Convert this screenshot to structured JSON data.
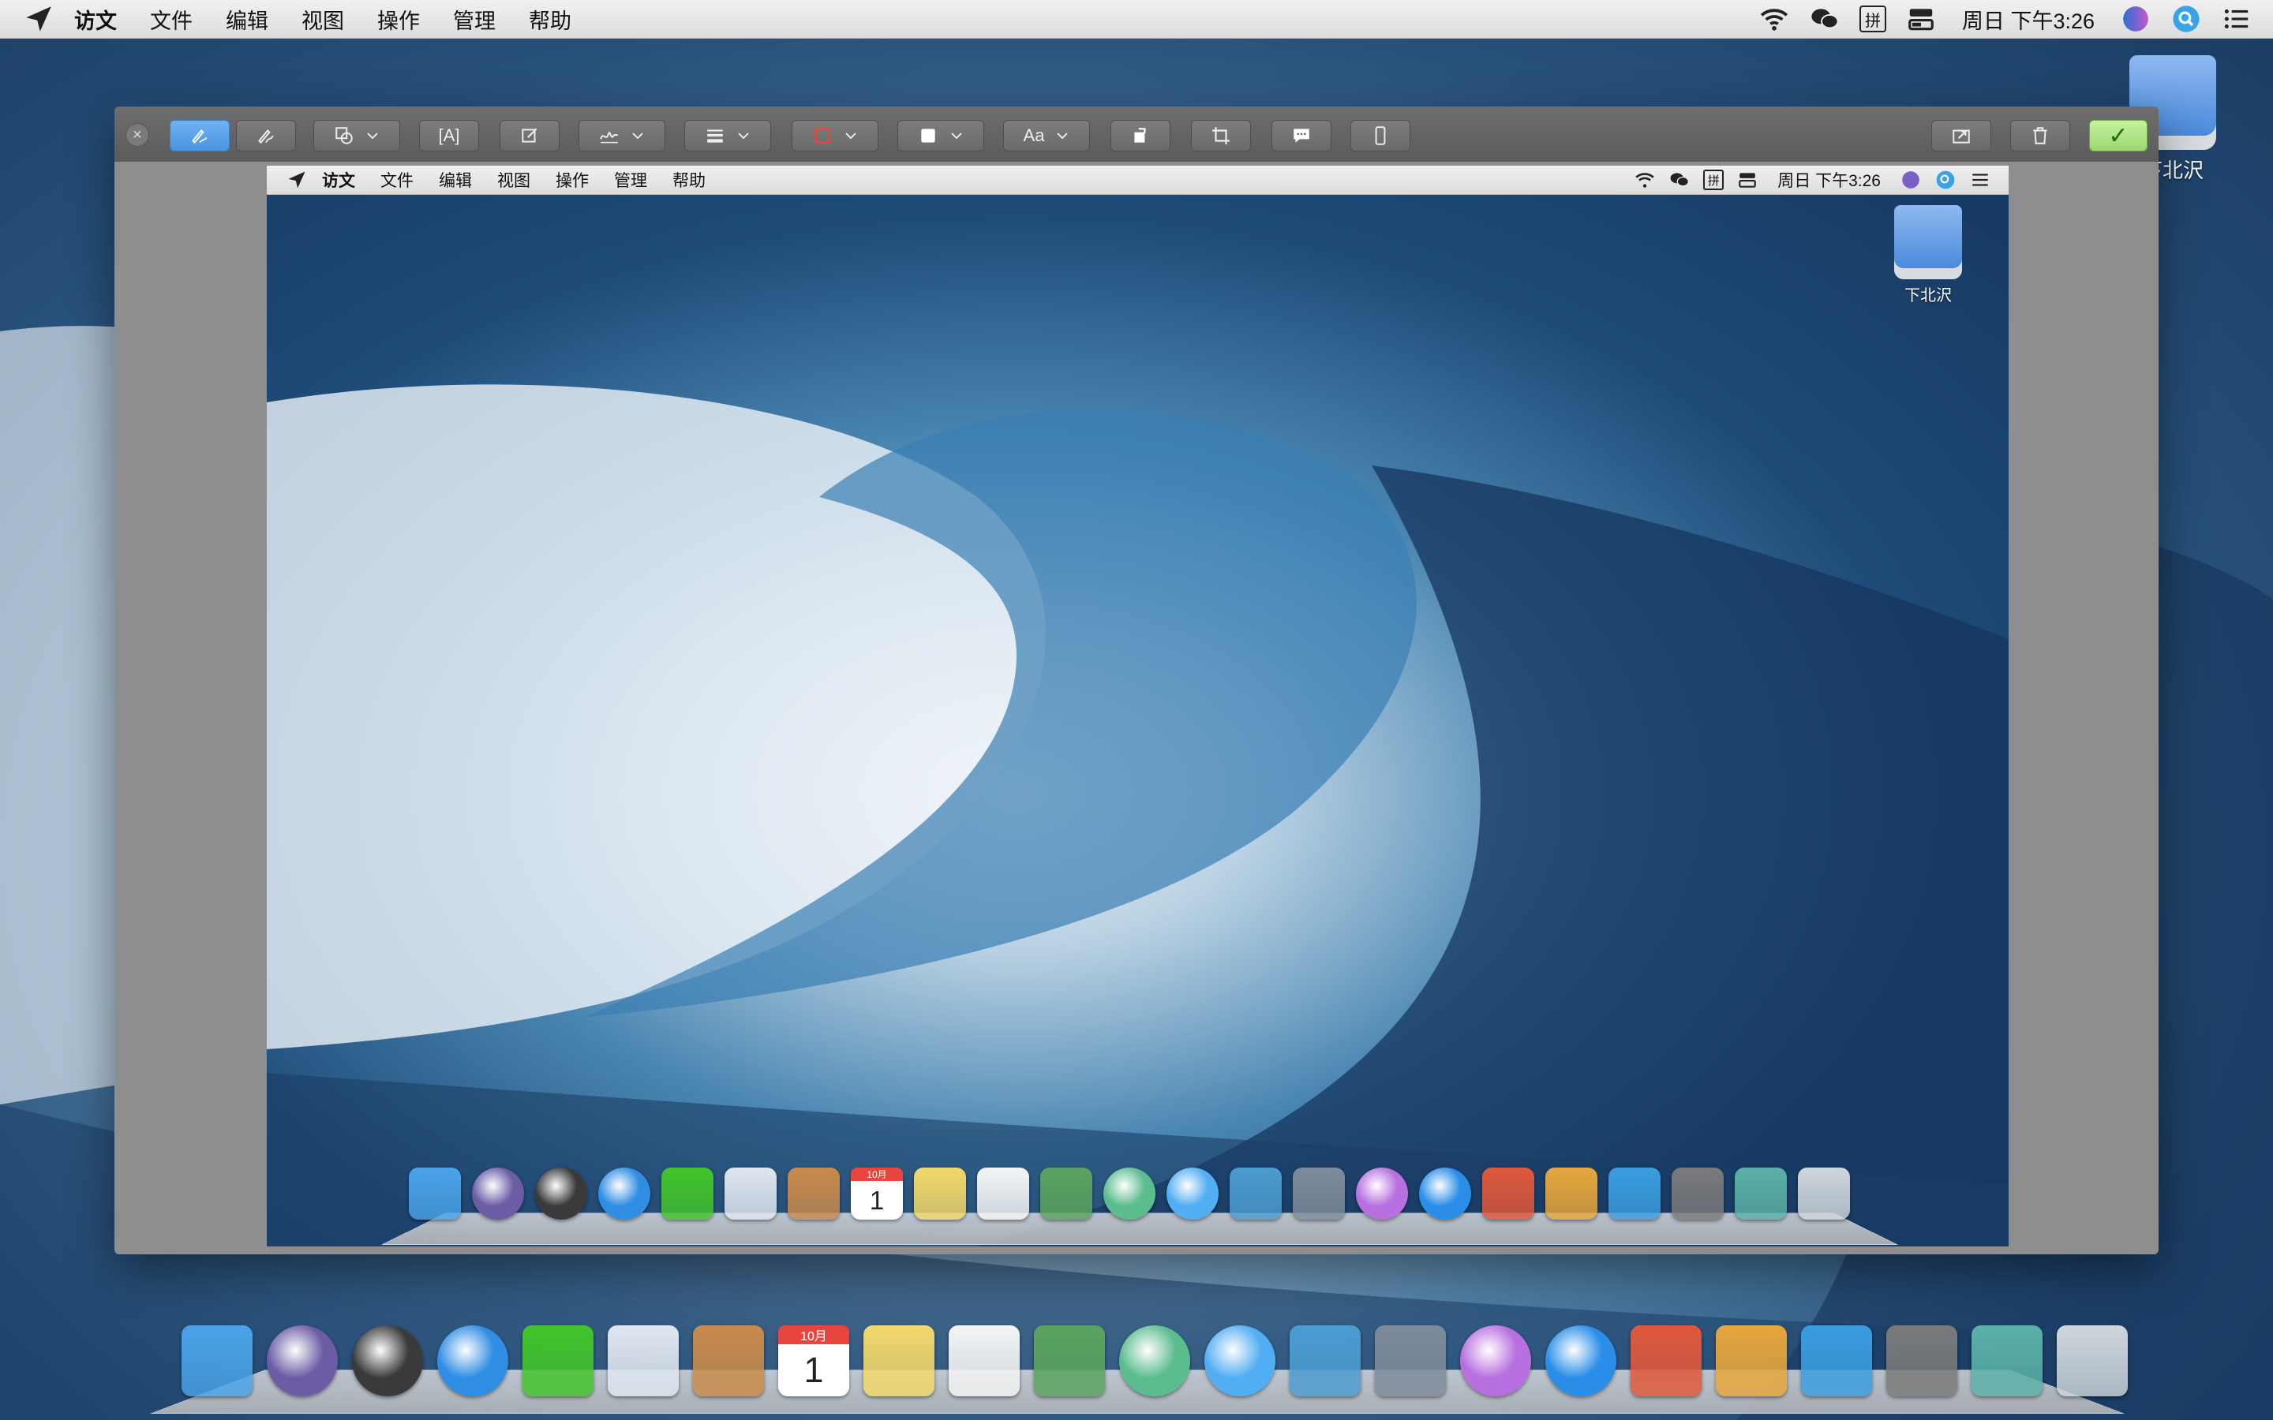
{
  "menubar": {
    "app_name": "访文",
    "menus": [
      "文件",
      "编辑",
      "视图",
      "操作",
      "管理",
      "帮助"
    ],
    "clock": "周日 下午3:26",
    "status_icons": [
      "wifi-icon",
      "wechat-icon",
      "input-method-icon",
      "control-strip-icon",
      "siri-icon",
      "spotlight-icon",
      "notification-center-icon"
    ],
    "input_method_label": "拼"
  },
  "desktop": {
    "drive_label": "下北沢"
  },
  "editor": {
    "tools": [
      {
        "name": "sketch-tool",
        "active": true
      },
      {
        "name": "draw-tool",
        "active": false
      },
      {
        "name": "shapes-tool",
        "active": false,
        "dropdown": true
      },
      {
        "name": "text-tool",
        "active": false,
        "label": "[A]"
      },
      {
        "name": "note-tool",
        "active": false
      },
      {
        "name": "sign-tool",
        "active": false,
        "dropdown": true
      },
      {
        "name": "line-style-tool",
        "active": false,
        "dropdown": true
      },
      {
        "name": "border-color-tool",
        "active": false,
        "dropdown": true
      },
      {
        "name": "fill-color-tool",
        "active": false,
        "dropdown": true
      },
      {
        "name": "text-style-tool",
        "active": false,
        "dropdown": true,
        "label": "Aa"
      },
      {
        "name": "rotate-tool",
        "active": false
      },
      {
        "name": "crop-tool",
        "active": false
      },
      {
        "name": "speech-bubble-tool",
        "active": false
      },
      {
        "name": "device-frame-tool",
        "active": false
      }
    ],
    "share_label": "share",
    "delete_label": "delete",
    "done_label": "✓"
  },
  "inner_screenshot": {
    "app_name": "访文",
    "menus": [
      "文件",
      "编辑",
      "视图",
      "操作",
      "管理",
      "帮助"
    ],
    "clock": "周日 下午3:26",
    "input_method_label": "拼",
    "drive_label": "下北沢"
  },
  "dock": {
    "calendar_month": "10月",
    "calendar_day": "1",
    "apps": [
      "finder",
      "siri",
      "launchpad",
      "safari",
      "wechat",
      "mail",
      "contacts",
      "calendar",
      "notes",
      "reminders",
      "image-upload",
      "photos",
      "messages",
      "facetime",
      "image-capture",
      "itunes",
      "keynote-viewer",
      "pages",
      "keynote",
      "numbers",
      "system-preferences",
      "downloads",
      "trash"
    ],
    "colors": {
      "finder": "#4aa3e8",
      "siri": "#6b5ca5",
      "launchpad": "#3a3a3a",
      "safari": "#2f8de4",
      "wechat": "#42c42a",
      "mail": "#dfe6ef",
      "contacts": "#c98a4a",
      "calendar": "#ffffff",
      "notes": "#f3d86a",
      "reminders": "#f4f4f4",
      "image-upload": "#5aa35e",
      "photos": "#5bbd8e",
      "messages": "#52aef2",
      "facetime": "#4c9cd1",
      "image-capture": "#7e8b9a",
      "itunes": "#b86fe0",
      "keynote-viewer": "#2a8ee8",
      "pages": "#e0583a",
      "keynote": "#e8a63c",
      "numbers": "#3b9de0",
      "system-preferences": "#7a7a7a",
      "downloads": "#5bb1a8",
      "trash": "#cfd6dc"
    }
  }
}
